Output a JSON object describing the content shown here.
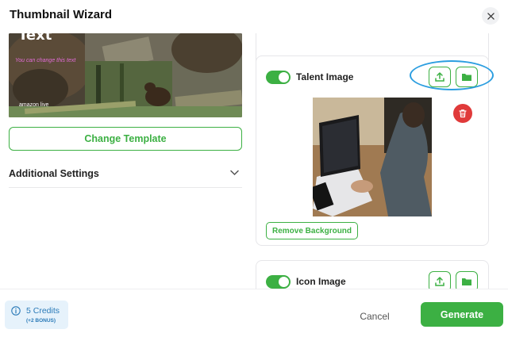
{
  "modal": {
    "title": "Thumbnail Wizard"
  },
  "preview": {
    "overlay_title": "Text",
    "overlay_subtitle": "You can change this text",
    "brand_label": "amazon live"
  },
  "left": {
    "change_template_label": "Change Template",
    "additional_settings_label": "Additional Settings"
  },
  "talent_card": {
    "label": "Talent Image",
    "enabled": true,
    "remove_background_label": "Remove Background"
  },
  "icon_card": {
    "label": "Icon Image",
    "enabled": true
  },
  "footer": {
    "credits_label": "5 Credits",
    "bonus_label": "(+2 BONUS)",
    "cancel_label": "Cancel",
    "generate_label": "Generate"
  },
  "colors": {
    "accent": "#3cb043",
    "delete": "#e03a3a",
    "highlight": "#2c9ee0",
    "credits_bg": "#e6f2fb"
  },
  "icons": [
    "close-icon",
    "chevron-down-icon",
    "upload-icon",
    "folder-icon",
    "trash-icon",
    "info-icon"
  ]
}
